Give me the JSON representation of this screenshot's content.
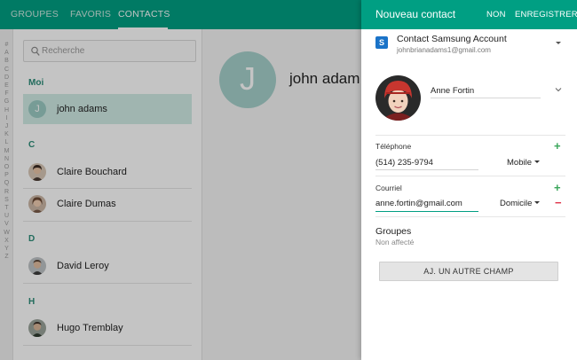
{
  "tabs": [
    {
      "label": "GROUPES",
      "active": false
    },
    {
      "label": "FAVORIS",
      "active": false
    },
    {
      "label": "CONTACTS",
      "active": true
    }
  ],
  "alphabet": [
    "#",
    "A",
    "B",
    "C",
    "D",
    "E",
    "F",
    "G",
    "H",
    "I",
    "J",
    "K",
    "L",
    "M",
    "N",
    "O",
    "P",
    "Q",
    "R",
    "S",
    "T",
    "U",
    "V",
    "W",
    "X",
    "Y",
    "Z"
  ],
  "search": {
    "placeholder": "Recherche",
    "icon": "search-icon"
  },
  "contact_list": {
    "me_header": "Moi",
    "me": {
      "name": "john adams",
      "initial": "J"
    },
    "sections": [
      {
        "letter": "C",
        "contacts": [
          "Claire Bouchard",
          "Claire Dumas"
        ]
      },
      {
        "letter": "D",
        "contacts": [
          "David Leroy"
        ]
      },
      {
        "letter": "H",
        "contacts": [
          "Hugo Tremblay"
        ]
      }
    ]
  },
  "detail": {
    "initial": "J",
    "name": "john adam"
  },
  "drawer": {
    "title": "Nouveau contact",
    "cancel_label": "NON",
    "save_label": "ENREGISTRER",
    "account": {
      "title": "Contact Samsung Account",
      "email": "johnbrianadams1@gmail.com",
      "icon_letter": "S"
    },
    "name_value": "Anne Fortin",
    "phone": {
      "label": "Téléphone",
      "value": "(514) 235-9794",
      "type": "Mobile"
    },
    "email": {
      "label": "Courriel",
      "value": "anne.fortin@gmail.com",
      "type": "Domicile"
    },
    "groups": {
      "title": "Groupes",
      "value": "Non affecté"
    },
    "add_field_label": "AJ. UN AUTRE CHAMP",
    "plus_symbol": "+",
    "minus_symbol": "−"
  },
  "colors": {
    "accent": "#009f83",
    "section_green": "#2b8c78",
    "add_green": "#3aa65a",
    "remove_red": "#e0344a"
  }
}
